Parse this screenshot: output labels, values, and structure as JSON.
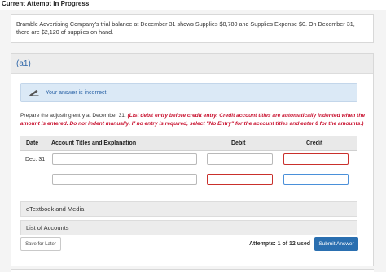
{
  "header": {
    "title": "Current Attempt in Progress"
  },
  "problem": {
    "text": "Bramble Advertising Company's trial balance at December 31 shows Supplies $8,780 and Supplies Expense $0. On December 31, there are $2,120 of supplies on hand."
  },
  "part": {
    "label": "(a1)",
    "feedback": "Your answer is incorrect.",
    "instruction_plain": "Prepare the adjusting entry at December 31.",
    "instruction_red": "(List debit entry before credit entry. Credit account titles are automatically indented when the amount is entered. Do not indent manually. If no entry is required, select \"No Entry\" for the account titles and enter 0 for the amounts.)",
    "table": {
      "headers": {
        "date": "Date",
        "account": "Account Titles and Explanation",
        "debit": "Debit",
        "credit": "Credit"
      },
      "rows": [
        {
          "date": "Dec. 31",
          "account": "",
          "debit": "",
          "credit": ""
        },
        {
          "date": "",
          "account": "",
          "debit": "",
          "credit": ""
        }
      ]
    },
    "accordions": {
      "etextbook": "eTextbook and Media",
      "accounts": "List of Accounts"
    },
    "footer": {
      "save": "Save for Later",
      "attempts_label": "Attempts:",
      "attempts_value": "1 of 12 used",
      "submit": "Submit Answer"
    }
  },
  "colors": {
    "accent": "#2a6fb0",
    "error": "#c9302c",
    "feedback_bg": "#dbe9f6",
    "link": "#2f66a8"
  }
}
